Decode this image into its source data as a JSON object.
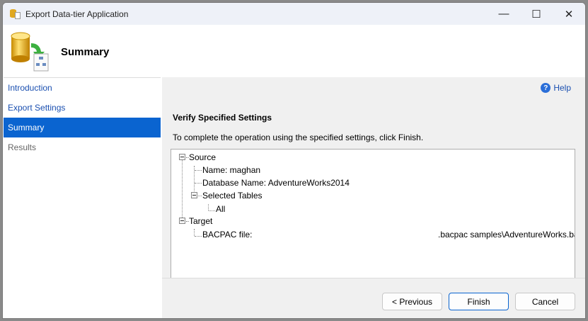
{
  "window": {
    "title": "Export Data-tier Application",
    "minimize": "—",
    "maximize": "☐",
    "close": "✕"
  },
  "header": {
    "title": "Summary"
  },
  "nav": {
    "items": [
      {
        "label": "Introduction"
      },
      {
        "label": "Export Settings"
      },
      {
        "label": "Summary"
      },
      {
        "label": "Results"
      }
    ]
  },
  "main": {
    "help": "Help",
    "help_icon": "?",
    "heading": "Verify Specified Settings",
    "instruction": "To complete the operation using the specified settings, click Finish."
  },
  "tree": {
    "source": "Source",
    "name": "Name: maghan",
    "database": "Database Name: AdventureWorks2014",
    "selected_tables": "Selected Tables",
    "all": "All",
    "target": "Target",
    "bacpac_label": "BACPAC file:",
    "bacpac_value": ".bacpac samples\\AdventureWorks.ba"
  },
  "buttons": {
    "previous": "< Previous",
    "finish": "Finish",
    "cancel": "Cancel"
  },
  "colors": {
    "accent": "#0a64d0",
    "link": "#1a4fb0"
  }
}
